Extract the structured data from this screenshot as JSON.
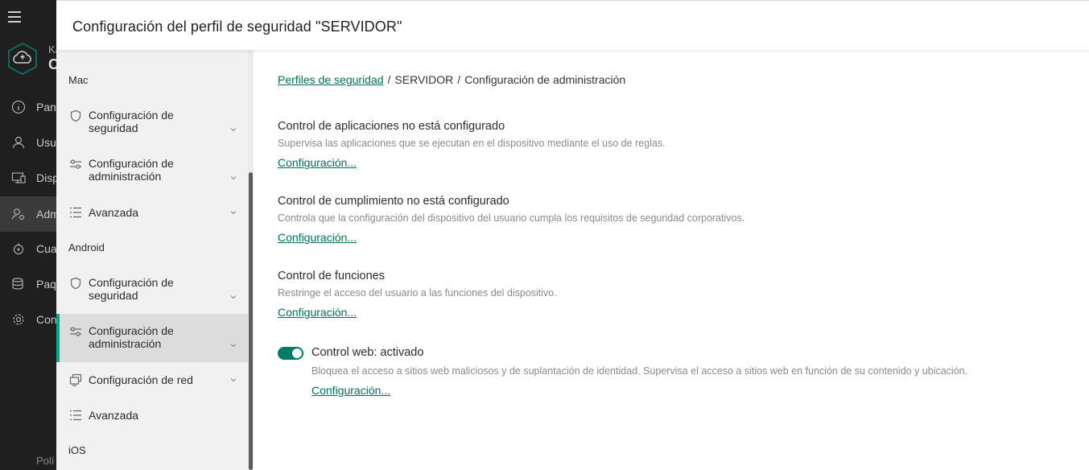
{
  "appnav": {
    "logo_text_line1": "Ka",
    "logo_text_line2": "C",
    "items": [
      {
        "label": "Pane",
        "icon": "info-icon"
      },
      {
        "label": "Usua",
        "icon": "user-icon"
      },
      {
        "label": "Disp",
        "icon": "devices-icon"
      },
      {
        "label": "Adm",
        "icon": "admin-icon"
      },
      {
        "label": "Cua",
        "icon": "quarantine-icon"
      },
      {
        "label": "Paq",
        "icon": "packages-icon"
      },
      {
        "label": "Con",
        "icon": "gear-icon"
      }
    ],
    "bottom_label": "Polí"
  },
  "header": {
    "title": "Configuración del perfil de seguridad \"SERVIDOR\""
  },
  "sidebar": {
    "groups": {
      "mac": "Mac",
      "android": "Android",
      "ios": "iOS"
    },
    "mac_items": [
      {
        "label": "Configuración de seguridad",
        "icon": "shield-icon"
      },
      {
        "label": "Configuración de administración",
        "icon": "sliders-icon"
      },
      {
        "label": "Avanzada",
        "icon": "list-icon"
      }
    ],
    "android_items": [
      {
        "label": "Configuración de seguridad",
        "icon": "shield-icon"
      },
      {
        "label": "Configuración de administración",
        "icon": "sliders-icon",
        "selected": true
      },
      {
        "label": "Configuración de red",
        "icon": "network-icon"
      },
      {
        "label": "Avanzada",
        "icon": "list-icon"
      }
    ]
  },
  "breadcrumb": {
    "link": "Perfiles de seguridad",
    "sep1": "/",
    "profile": "SERVIDOR",
    "sep2": "/",
    "current": "Configuración de administración"
  },
  "sections": {
    "app_control": {
      "title": "Control de aplicaciones no está configurado",
      "desc": "Supervisa las aplicaciones que se ejecutan en el dispositivo mediante el uso de reglas.",
      "link": "Configuración..."
    },
    "compliance_control": {
      "title": "Control de cumplimiento no está configurado",
      "desc": "Controla que la configuración del dispositivo del usuario cumpla los requisitos de seguridad corporativos.",
      "link": "Configuración..."
    },
    "feature_control": {
      "title": "Control de funciones",
      "desc": "Restringe el acceso del usuario a las funciones del dispositivo.",
      "link": "Configuración..."
    },
    "web_control": {
      "title": "Control web: activado",
      "desc": "Bloquea el acceso a sitios web maliciosos y de suplantación de identidad. Supervisa el acceso a sitios web en función de su contenido y ubicación.",
      "link": "Configuración...",
      "enabled": true
    }
  },
  "colors": {
    "accent": "#00715c",
    "toggle_on": "#007a65",
    "selection_bar": "#00a88e",
    "nav_bg": "#1f1f1f"
  }
}
